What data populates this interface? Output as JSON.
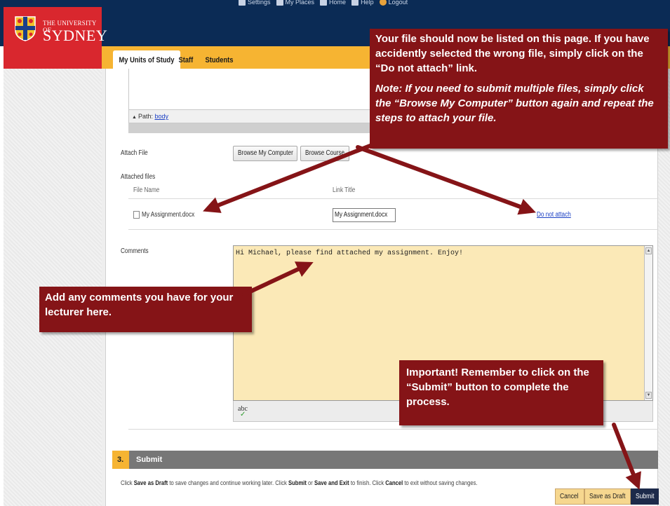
{
  "header": {
    "university_small": "THE UNIVERSITY OF",
    "university_big": "SYDNEY",
    "top_links": [
      {
        "label": "Settings",
        "icon": "settings-icon"
      },
      {
        "label": "My Places",
        "icon": "places-icon"
      },
      {
        "label": "Home",
        "icon": "home-icon"
      },
      {
        "label": "Help",
        "icon": "help-icon"
      },
      {
        "label": "Logout",
        "icon": "logout-icon"
      }
    ],
    "tabs": [
      {
        "label": "My Units of Study",
        "active": true
      },
      {
        "label": "Staff",
        "active": false
      },
      {
        "label": "Students",
        "active": false
      }
    ]
  },
  "editor": {
    "path_label": "Path:",
    "path_value": "body"
  },
  "attach": {
    "label": "Attach File",
    "browse_computer": "Browse My Computer",
    "browse_course": "Browse Course",
    "attached_files_label": "Attached files",
    "col_file_name": "File Name",
    "col_link_title": "Link Title",
    "file_name": "My Assignment.docx",
    "link_title": "My Assignment.docx",
    "do_not_attach": "Do not attach"
  },
  "comments": {
    "label": "Comments",
    "text": "Hi Michael, please find attached my assignment.  Enjoy!",
    "spell_icon": "abc"
  },
  "submit_section": {
    "number": "3.",
    "title": "Submit",
    "help_parts": [
      "Click ",
      "Save as Draft",
      " to save changes and continue working later. Click ",
      "Submit",
      " or ",
      "Save and Exit",
      " to finish. Click ",
      "Cancel",
      " to exit without saving changes."
    ],
    "cancel": "Cancel",
    "save_draft": "Save as Draft",
    "submit": "Submit"
  },
  "callouts": {
    "top": "Your file should now be listed on this page.  If you have accidently selected the wrong file, simply click on the “Do not attach” link.",
    "top_note": "Note:  If you need to submit multiple files, simply click the “Browse My Computer” button again and repeat the steps to attach your file.",
    "left": "Add any comments you have for your lecturer here.",
    "bottom": "Important!  Remember to click on the “Submit” button to complete the process."
  },
  "colors": {
    "header_blue": "#0b2b55",
    "logo_red": "#d9272e",
    "tab_yellow": "#f6b432",
    "callout_maroon": "#851417",
    "comment_bg": "#fbe9b7"
  }
}
